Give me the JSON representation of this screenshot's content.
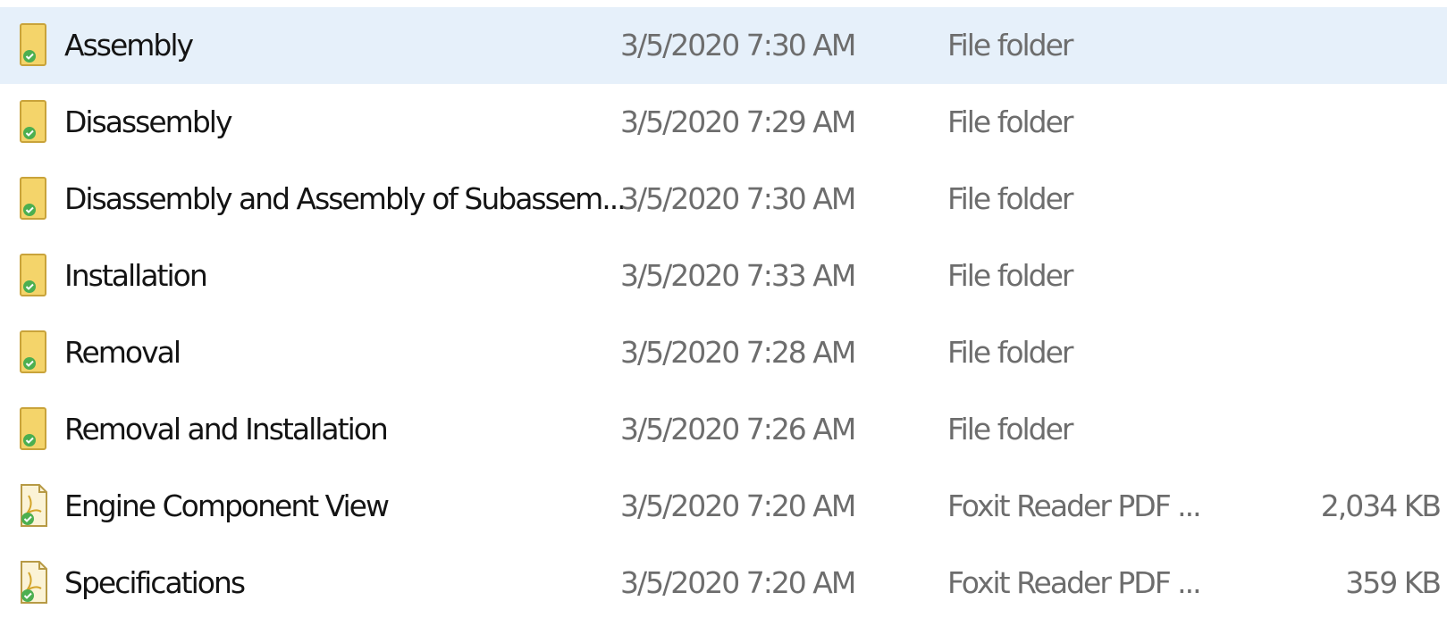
{
  "files": [
    {
      "name": "Assembly",
      "date": "3/5/2020 7:30 AM",
      "type": "File folder",
      "size": "",
      "icon": "folder-synced-icon",
      "selected": true
    },
    {
      "name": "Disassembly",
      "date": "3/5/2020 7:29 AM",
      "type": "File folder",
      "size": "",
      "icon": "folder-synced-icon",
      "selected": false
    },
    {
      "name": "Disassembly and Assembly of Subassem...",
      "date": "3/5/2020 7:30 AM",
      "type": "File folder",
      "size": "",
      "icon": "folder-synced-icon",
      "selected": false
    },
    {
      "name": "Installation",
      "date": "3/5/2020 7:33 AM",
      "type": "File folder",
      "size": "",
      "icon": "folder-synced-icon",
      "selected": false
    },
    {
      "name": "Removal",
      "date": "3/5/2020 7:28 AM",
      "type": "File folder",
      "size": "",
      "icon": "folder-synced-icon",
      "selected": false
    },
    {
      "name": "Removal and Installation",
      "date": "3/5/2020 7:26 AM",
      "type": "File folder",
      "size": "",
      "icon": "folder-synced-icon",
      "selected": false
    },
    {
      "name": "Engine Component View",
      "date": "3/5/2020 7:20 AM",
      "type": "Foxit Reader PDF ...",
      "size": "2,034 KB",
      "icon": "pdf-file-synced-icon",
      "selected": false
    },
    {
      "name": "Specifications",
      "date": "3/5/2020 7:20 AM",
      "type": "Foxit Reader PDF ...",
      "size": "359 KB",
      "icon": "pdf-file-synced-icon",
      "selected": false
    }
  ],
  "colors": {
    "selection": "#e6f0fa",
    "folder": "#f4d46a",
    "sync_check": "#4caf50",
    "secondary_text": "#6d6d6d"
  }
}
